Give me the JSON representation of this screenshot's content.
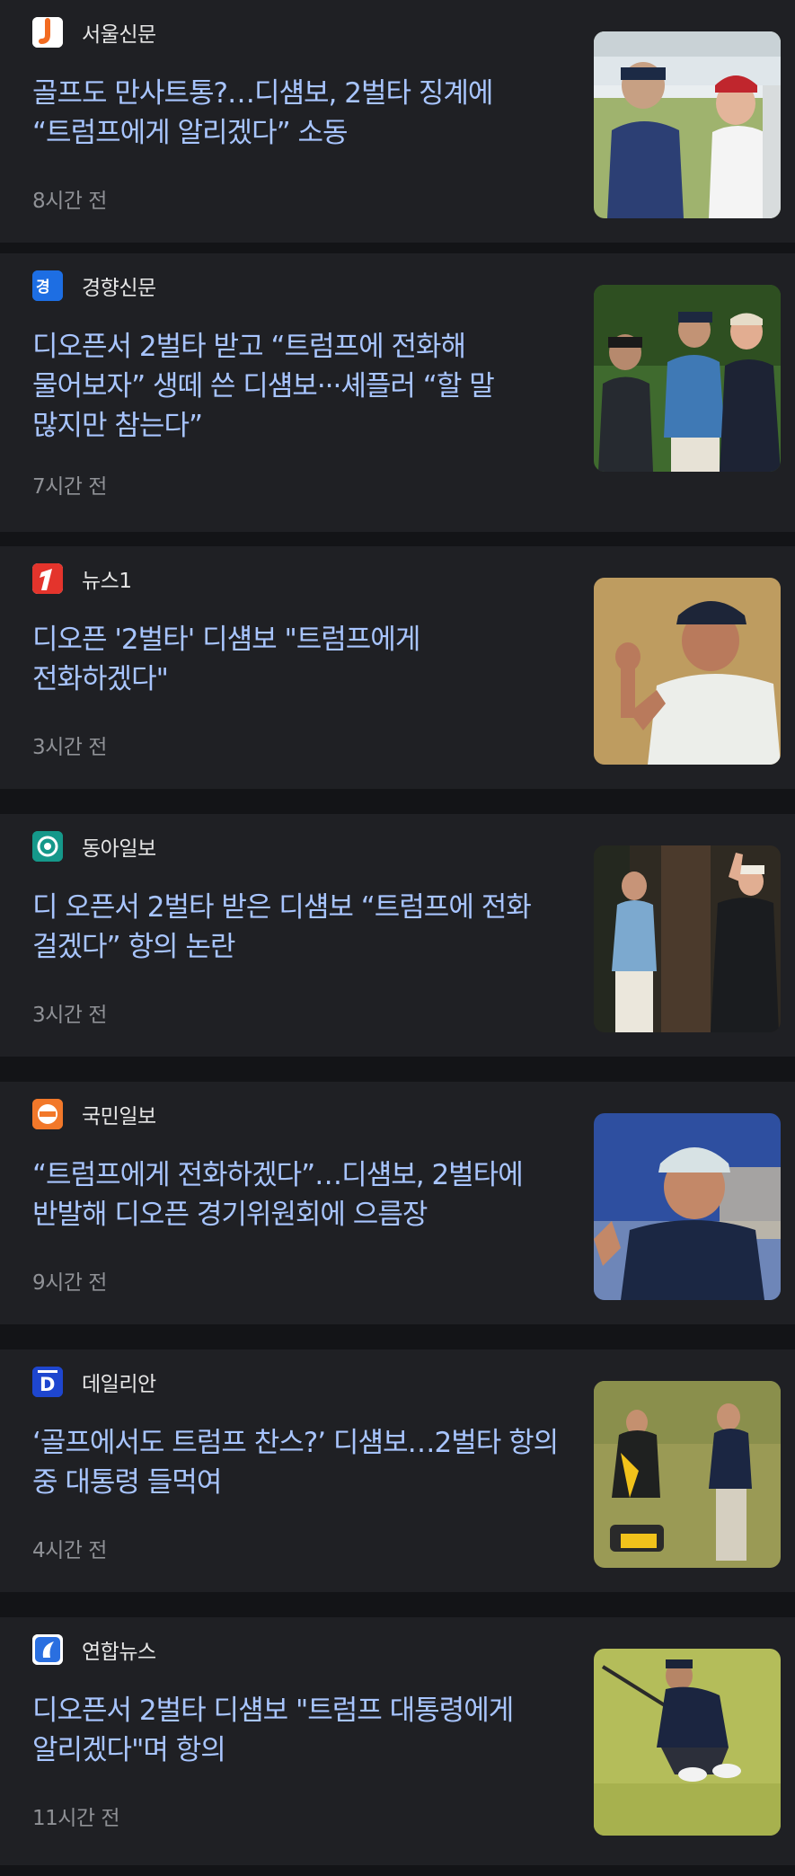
{
  "articles": [
    {
      "press": "서울신문",
      "headline": "골프도 만사트통?…디섐보, 2벌타 징계에 “트럼프에게 알리겠다” 소동",
      "time": "8시간 전",
      "logo_icon": "seoul-shinmun-logo",
      "thumb_icon": "golf-cart-photo-icon"
    },
    {
      "press": "경향신문",
      "headline": "디오픈서 2벌타 받고 “트럼프에 전화해 물어보자” 생떼 쓴 디섐보···셰플러 “할 말 많지만 참는다”",
      "time": "7시간 전",
      "logo_icon": "kyunghyang-logo",
      "thumb_icon": "golfers-group-photo-icon"
    },
    {
      "press": "뉴스1",
      "headline": "디오픈 '2벌타' 디섐보 \"트럼프에게 전화하겠다\"",
      "time": "3시간 전",
      "logo_icon": "news1-logo",
      "thumb_icon": "golfer-fist-pump-photo-icon"
    },
    {
      "press": "동아일보",
      "headline": "디 오픈서 2벌타 받은 디섐보 “트럼프에 전화 걸겠다” 항의 논란",
      "time": "3시간 전",
      "logo_icon": "donga-logo",
      "thumb_icon": "golfer-and-trump-photo-icon"
    },
    {
      "press": "국민일보",
      "headline": "“트럼프에게 전화하겠다”…디섐보, 2벌타에 반발해 디오픈 경기위원회에 으름장",
      "time": "9시간 전",
      "logo_icon": "kukmin-logo",
      "thumb_icon": "golfer-cap-closeup-photo-icon"
    },
    {
      "press": "데일리안",
      "headline": "‘골프에서도 트럼프 찬스?’ 디섐보…2벌타 항의 중 대통령 들먹여",
      "time": "4시간 전",
      "logo_icon": "dailian-logo",
      "thumb_icon": "golfer-and-caddie-photo-icon"
    },
    {
      "press": "연합뉴스",
      "headline": "디오픈서 2벌타 디섐보 \"트럼프 대통령에게 알리겠다\"며 항의",
      "time": "11시간 전",
      "logo_icon": "yonhap-logo",
      "thumb_icon": "golfer-crouching-photo-icon"
    }
  ],
  "colors": {
    "background": "#131417",
    "card": "#1f2024",
    "headline": "#a8c5ff",
    "press_name": "#e6e6e6",
    "time": "#8f9196"
  }
}
